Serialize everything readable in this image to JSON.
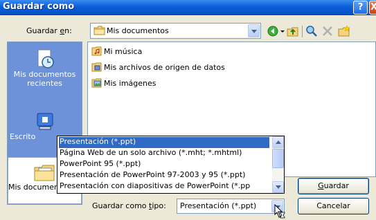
{
  "window": {
    "title": "Guardar como",
    "help_label": "?",
    "close_label": "X"
  },
  "save_in": {
    "label_prefix": "Guardar ",
    "label_accel": "e",
    "label_suffix": "n:",
    "value": "Mis documentos"
  },
  "toolbar": {
    "icons": [
      "back-icon",
      "up-folder-icon",
      "search-web-icon",
      "delete-icon",
      "new-folder-icon"
    ]
  },
  "places": {
    "items": [
      {
        "label_line1": "Mis documentos",
        "label_line2": "recientes",
        "icon": "recent-documents-icon"
      },
      {
        "label_line1": "Escrito",
        "label_line2": "",
        "icon": "desktop-icon"
      },
      {
        "label_line1": "Mis documentos",
        "label_line2": "",
        "icon": "my-documents-icon"
      }
    ]
  },
  "files": [
    {
      "name": "Mi música",
      "icon": "music-folder-icon"
    },
    {
      "name": "Mis archivos de origen de datos",
      "icon": "data-sources-folder-icon"
    },
    {
      "name": "Mis imágenes",
      "icon": "pictures-folder-icon"
    }
  ],
  "file_type": {
    "label_prefix": "Guardar como ",
    "label_accel": "t",
    "label_suffix": "ipo:",
    "value": "Presentación (*.ppt)",
    "options": [
      "Presentación (*.ppt)",
      "Página Web de un solo archivo (*.mht; *.mhtml)",
      "PowerPoint 95 (*.ppt)",
      "Presentación de PowerPoint 97-2003 y 95 (*.ppt)",
      "Presentación con diapositivas de PowerPoint (*.pp"
    ],
    "selected_index": 0
  },
  "buttons": {
    "save_accel": "G",
    "save_rest": "uardar",
    "cancel": "Cancelar"
  },
  "colors": {
    "titlebar": "#0a5fd8",
    "places_bar": "#6d92d9",
    "selection": "#316ac5",
    "dialog_bg": "#ece9d8"
  }
}
